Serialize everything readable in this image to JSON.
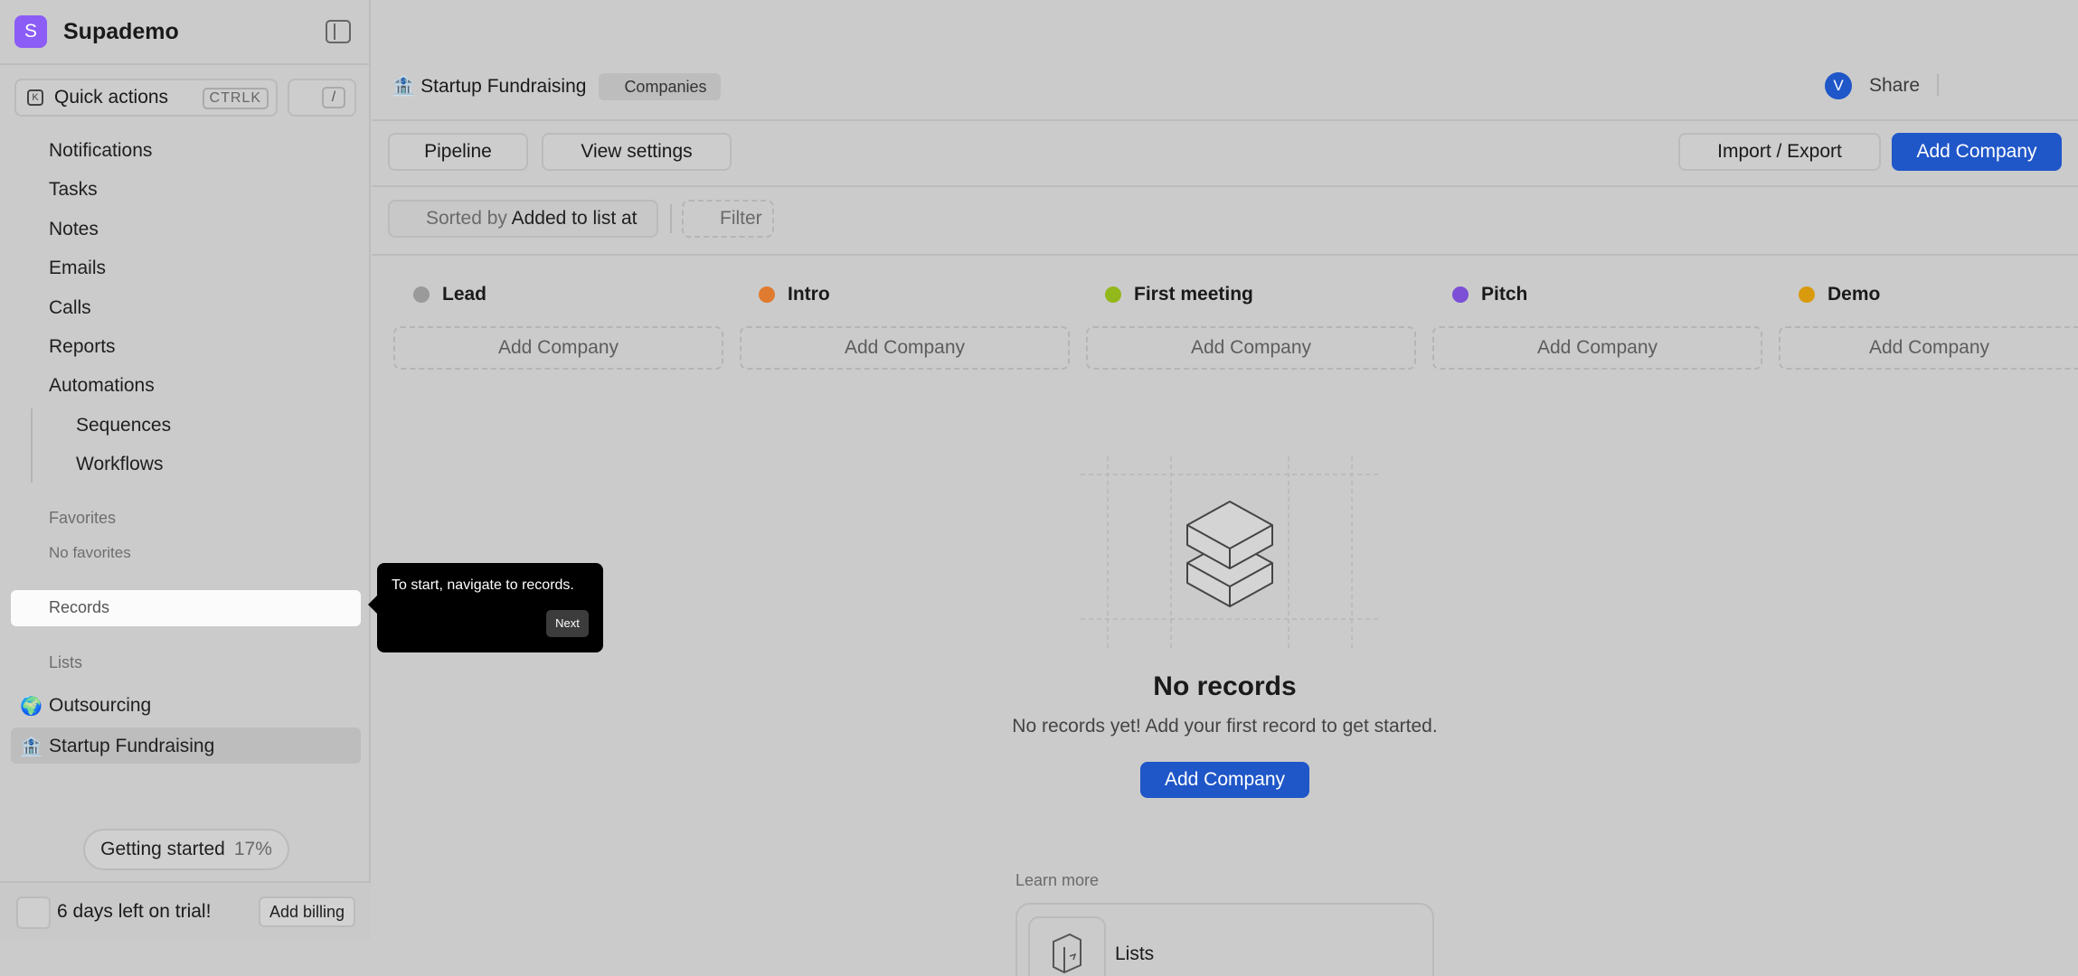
{
  "workspace": {
    "logo_letter": "S",
    "name": "Supademo"
  },
  "quick_actions": {
    "label": "Quick actions",
    "shortcut": "CTRLK",
    "slash": "/"
  },
  "nav": {
    "items": [
      "Notifications",
      "Tasks",
      "Notes",
      "Emails",
      "Calls",
      "Reports",
      "Automations"
    ],
    "sub_items": [
      "Sequences",
      "Workflows"
    ]
  },
  "favorites": {
    "label": "Favorites",
    "empty": "No favorites"
  },
  "records": {
    "label": "Records"
  },
  "lists": {
    "label": "Lists",
    "items": [
      {
        "emoji": "🌍",
        "label": "Outsourcing"
      },
      {
        "emoji": "🏦",
        "label": "Startup Fundraising"
      }
    ]
  },
  "getting_started": {
    "label": "Getting started",
    "percent": "17%",
    "progress": 0.17
  },
  "trial": {
    "text": "6 days left on trial!",
    "billing": "Add billing"
  },
  "header": {
    "emoji": "🏦",
    "title": "Startup Fundraising",
    "tag": "Companies",
    "avatar": "V",
    "share": "Share"
  },
  "toolbar": {
    "pipeline": "Pipeline",
    "view_settings": "View settings",
    "import_export": "Import / Export",
    "add_company": "Add Company"
  },
  "sort": {
    "prefix": "Sorted by",
    "value": "Added to list at",
    "filter": "Filter"
  },
  "columns": [
    {
      "name": "Lead",
      "color": "#9a9a9a",
      "add": "Add Company"
    },
    {
      "name": "Intro",
      "color": "#e07a2e",
      "add": "Add Company"
    },
    {
      "name": "First meeting",
      "color": "#93b81b",
      "add": "Add Company"
    },
    {
      "name": "Pitch",
      "color": "#7c4fd6",
      "add": "Add Company"
    },
    {
      "name": "Demo",
      "color": "#d99a0e",
      "add": "Add Company"
    }
  ],
  "empty_state": {
    "title": "No records",
    "subtitle": "No records yet! Add your first record to get started.",
    "button": "Add Company"
  },
  "learn_more": {
    "label": "Learn more",
    "card": "Lists"
  },
  "tooltip": {
    "text": "To start, navigate to records.",
    "next": "Next"
  },
  "colors": {
    "primary": "#1f56c8",
    "workspace_logo": "#8b5cf6"
  }
}
